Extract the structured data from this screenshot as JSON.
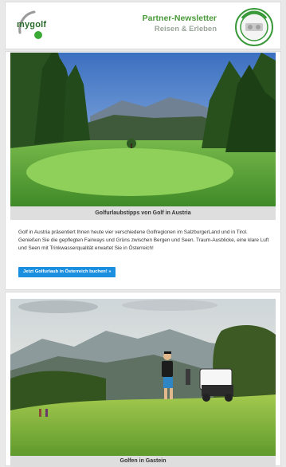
{
  "header": {
    "logo_text": "mygolf",
    "title": "Partner-Newsletter",
    "subtitle": "Reisen & Erleben",
    "badge_icon": "partner-badge-icon"
  },
  "article1": {
    "caption": "Golfurlaubstipps von Golf in Austria",
    "text": "Golf in Austria präsentiert Ihnen heute vier verschiedene Golfregionen im SalzburgerLand und in Tirol. Genießen Sie die gepflegten Fairways und Grüns zwischen Bergen und Seen. Traum-Ausblicke, eine klare Luft und Seen mit Trinkwasserqualität erwartet Sie in Österreich!",
    "button_label": "Jetzt Golfurlaub in Österreich buchen! »"
  },
  "article2": {
    "caption": "Golfen in Gastein"
  },
  "colors": {
    "brand_green": "#4a9a3a",
    "button_blue": "#1a8fe0",
    "caption_bg": "#dedede"
  }
}
